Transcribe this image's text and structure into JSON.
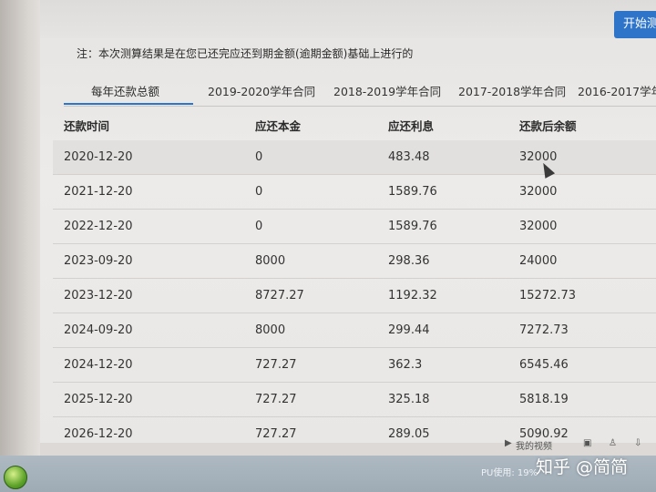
{
  "header": {
    "start_button": "开始测",
    "note": "注：本次测算结果是在您已还完应还到期金额(逾期金额)基础上进行的"
  },
  "tabs": [
    {
      "label": "每年还款总额",
      "active": true
    },
    {
      "label": "2019-2020学年合同",
      "active": false
    },
    {
      "label": "2018-2019学年合同",
      "active": false
    },
    {
      "label": "2017-2018学年合同",
      "active": false
    },
    {
      "label": "2016-2017学年",
      "active": false
    }
  ],
  "table": {
    "headers": [
      "还款时间",
      "应还本金",
      "应还利息",
      "还款后余额"
    ],
    "rows": [
      [
        "2020-12-20",
        "0",
        "483.48",
        "32000"
      ],
      [
        "2021-12-20",
        "0",
        "1589.76",
        "32000"
      ],
      [
        "2022-12-20",
        "0",
        "1589.76",
        "32000"
      ],
      [
        "2023-09-20",
        "8000",
        "298.36",
        "24000"
      ],
      [
        "2023-12-20",
        "8727.27",
        "1192.32",
        "15272.73"
      ],
      [
        "2024-09-20",
        "8000",
        "299.44",
        "7272.73"
      ],
      [
        "2024-12-20",
        "727.27",
        "362.3",
        "6545.46"
      ],
      [
        "2025-12-20",
        "727.27",
        "325.18",
        "5818.19"
      ],
      [
        "2026-12-20",
        "727.27",
        "289.05",
        "5090.92"
      ]
    ]
  },
  "video_bar": {
    "label": "我的视频",
    "icons": [
      "play-icon",
      "image-icon",
      "shirt-icon",
      "download-icon"
    ]
  },
  "taskbar": {
    "status": "PU使用: 19%"
  },
  "watermark": "知乎 @简简",
  "colors": {
    "accent": "#2e74c9",
    "taskbar": "#a5b1ba"
  }
}
